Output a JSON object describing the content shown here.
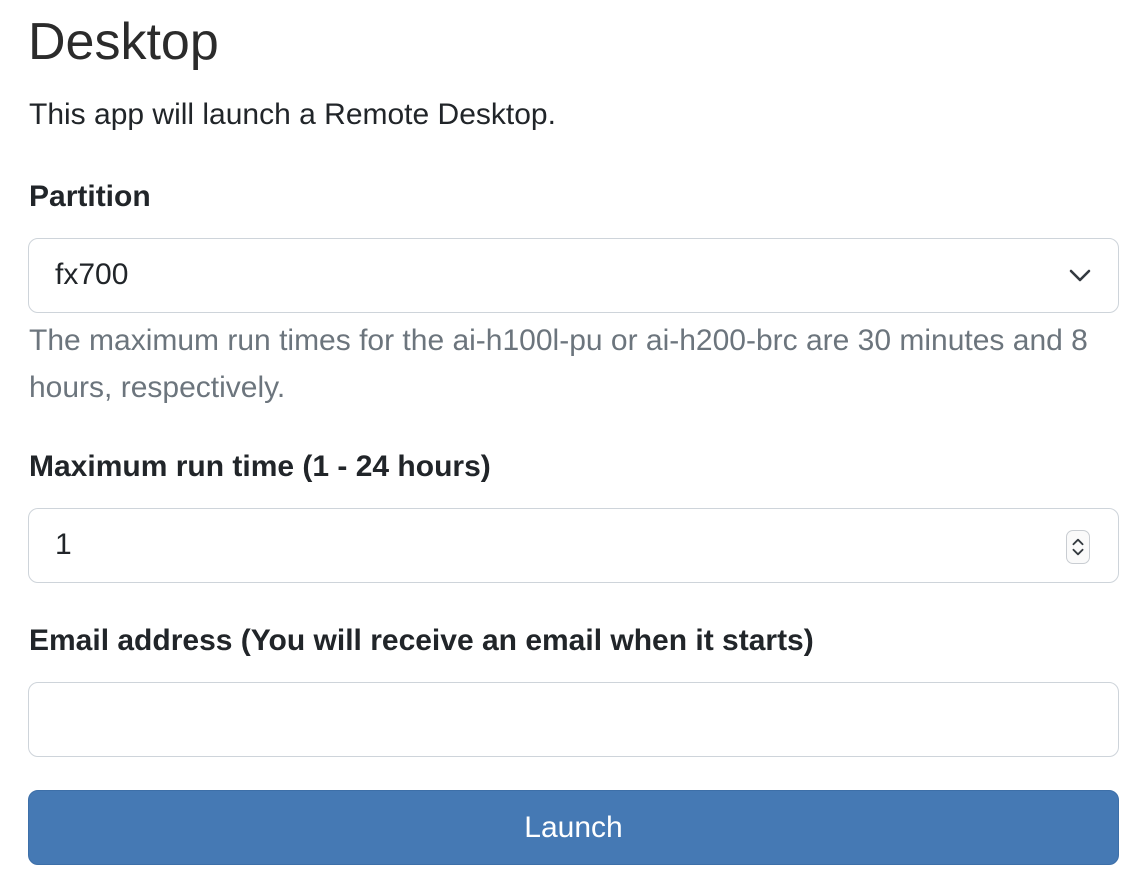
{
  "page": {
    "title": "Desktop",
    "description": "This app will launch a Remote Desktop."
  },
  "form": {
    "partition": {
      "label": "Partition",
      "selected": "fx700",
      "icon": "chevron-down-icon",
      "help": "The maximum run times for the ai-h100l-pu or ai-h200-brc are 30 minutes and 8 hours, respectively."
    },
    "run_time": {
      "label": "Maximum run time (1 - 24 hours)",
      "value": "1",
      "icon": "number-stepper-icon"
    },
    "email": {
      "label": "Email address (You will receive an email when it starts)",
      "value": "",
      "placeholder": ""
    },
    "submit": {
      "label": "Launch",
      "color": "#4579b4"
    }
  }
}
